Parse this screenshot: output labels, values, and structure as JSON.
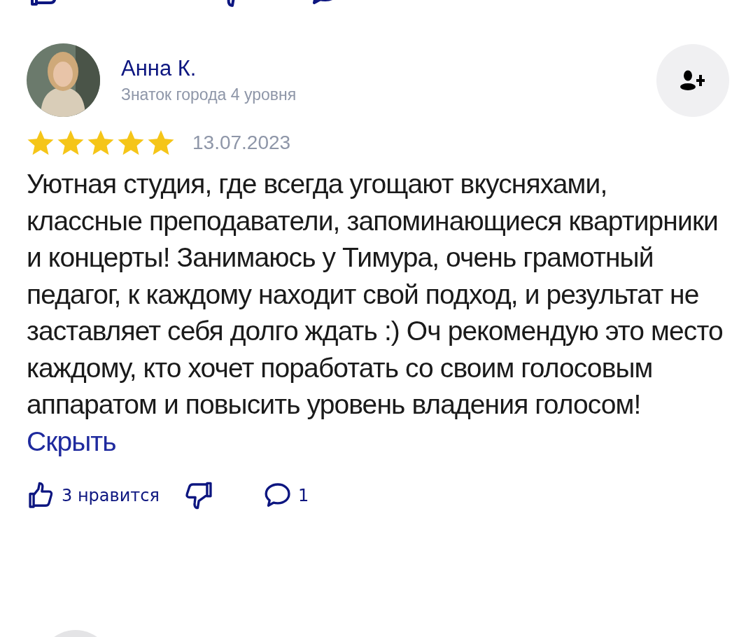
{
  "review": {
    "author": "Анна К.",
    "author_level": "Знаток города 4 уровня",
    "stars": 5,
    "date": "13.07.2023",
    "text": "Уютная студия, где всегда угощают вкусняхами, классные преподаватели, запоминающиеся квартирники и концерты! Занимаюсь у Тимура, очень грамотный педагог, к каждому находит свой подход, и результат не заставляет себя долго ждать :) Оч рекомендую это место каждому, кто хочет поработать со своим голосовым аппаратом и повысить уровень владения голосом!",
    "hide_link": "Скрыть",
    "likes": "3 нравится",
    "comments": "1"
  }
}
